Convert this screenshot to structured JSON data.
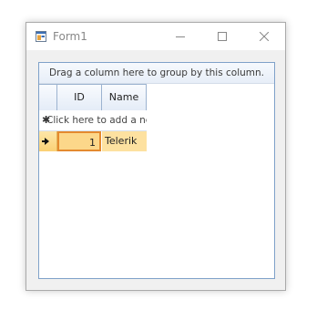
{
  "window": {
    "title": "Form1",
    "icons": {
      "app": "form-app-icon",
      "minimize": "minimize-icon",
      "maximize": "maximize-icon",
      "close": "close-icon"
    }
  },
  "grid": {
    "group_panel_text": "Drag a column here to group by this column.",
    "columns": [
      "ID",
      "Name"
    ],
    "new_row_text": "Click here to add a new row",
    "rows": [
      {
        "id": "1",
        "name": "Telerik"
      }
    ]
  },
  "colors": {
    "grid_border": "#7fa1c9",
    "selected_row": "#fde1a0",
    "current_cell_border": "#e48a2f"
  }
}
